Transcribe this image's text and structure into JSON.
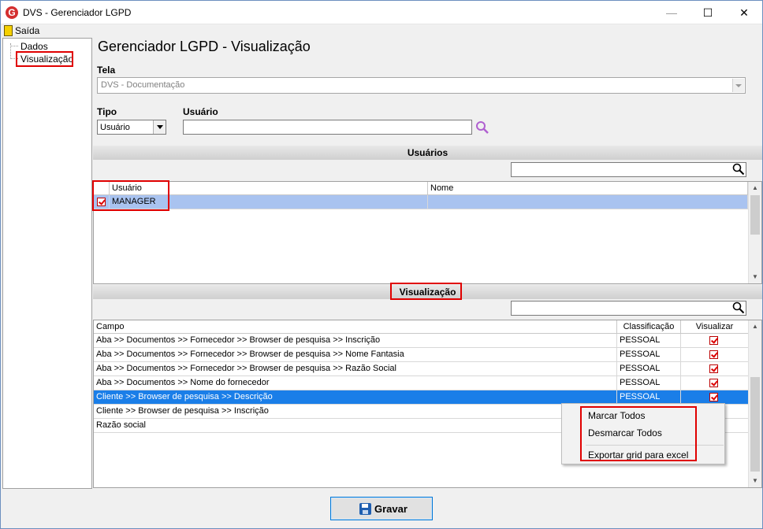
{
  "window": {
    "title": "DVS - Gerenciador LGPD",
    "minimize_glyph": "—",
    "maximize_glyph": "☐",
    "close_glyph": "✕",
    "app_icon": "G",
    "app_icon_color": "#d42f2f"
  },
  "menu": {
    "exit_label": "Saída"
  },
  "tree": {
    "items": [
      "Dados",
      "Visualização"
    ]
  },
  "page_title": "Gerenciador LGPD - Visualização",
  "form": {
    "tela_label": "Tela",
    "tela_value": "DVS - Documentação",
    "tipo_label": "Tipo",
    "tipo_value": "Usuário",
    "usuario_label": "Usuário",
    "usuario_value": ""
  },
  "users_section": {
    "title": "Usuários",
    "columns": [
      "Usuário",
      "Nome"
    ],
    "rows": [
      {
        "checked": true,
        "usuario": "MANAGER",
        "nome": ""
      }
    ]
  },
  "visual_section": {
    "title": "Visualização",
    "columns": [
      "Campo",
      "Classificação",
      "Visualizar"
    ],
    "rows": [
      {
        "campo": "Aba >> Documentos  >> Fornecedor >> Browser de pesquisa >> Inscrição",
        "classificacao": "PESSOAL",
        "visualizar": true
      },
      {
        "campo": "Aba >> Documentos  >> Fornecedor >> Browser de pesquisa >> Nome Fantasia",
        "classificacao": "PESSOAL",
        "visualizar": true
      },
      {
        "campo": "Aba >> Documentos  >> Fornecedor >> Browser de pesquisa >> Razão Social",
        "classificacao": "PESSOAL",
        "visualizar": true
      },
      {
        "campo": "Aba >> Documentos  >> Nome do fornecedor",
        "classificacao": "PESSOAL",
        "visualizar": true
      },
      {
        "campo": "Cliente >> Browser de pesquisa >> Descrição",
        "classificacao": "PESSOAL",
        "visualizar": true
      },
      {
        "campo": "Cliente >> Browser de pesquisa >> Inscrição",
        "classificacao": "",
        "visualizar": false
      },
      {
        "campo": "Razão social",
        "classificacao": "",
        "visualizar": false
      }
    ]
  },
  "context_menu": {
    "items": [
      "Marcar Todos",
      "Desmarcar Todos",
      "Exportar grid para excel"
    ]
  },
  "save_button": {
    "label": "Gravar",
    "accent": "G"
  },
  "colors": {
    "highlight": "#e00000",
    "selection": "#1a7ee8",
    "selection_light": "#a9c3f0"
  }
}
